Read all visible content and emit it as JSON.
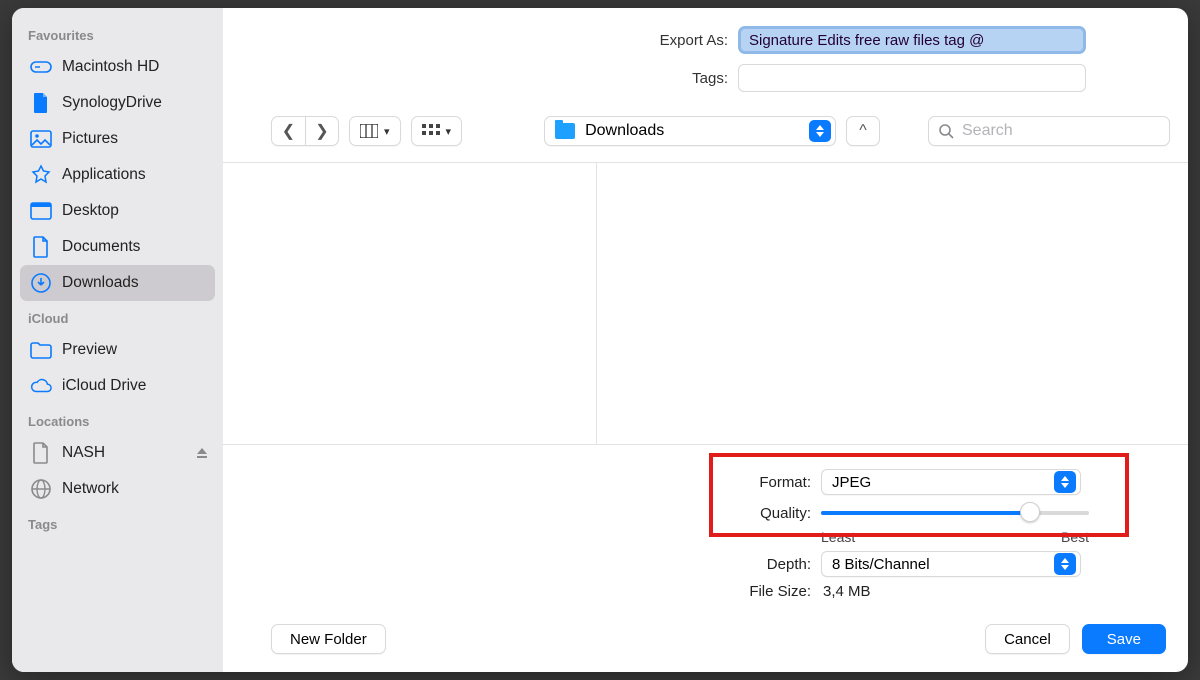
{
  "header": {
    "export_as_label": "Export As:",
    "filename_value": "Signature Edits free raw files tag @",
    "tags_label": "Tags:",
    "tags_value": ""
  },
  "toolbar": {
    "location_label": "Downloads",
    "search_placeholder": "Search"
  },
  "sidebar": {
    "favourites_header": "Favourites",
    "favourites": [
      {
        "label": "Macintosh HD",
        "icon": "disk"
      },
      {
        "label": "SynologyDrive",
        "icon": "doc"
      },
      {
        "label": "Pictures",
        "icon": "picture"
      },
      {
        "label": "Applications",
        "icon": "apps"
      },
      {
        "label": "Desktop",
        "icon": "desktop"
      },
      {
        "label": "Documents",
        "icon": "document"
      },
      {
        "label": "Downloads",
        "icon": "download",
        "selected": true
      }
    ],
    "icloud_header": "iCloud",
    "icloud": [
      {
        "label": "Preview",
        "icon": "folder"
      },
      {
        "label": "iCloud Drive",
        "icon": "cloud"
      }
    ],
    "locations_header": "Locations",
    "locations": [
      {
        "label": "NASH",
        "icon": "document",
        "ejectable": true
      },
      {
        "label": "Network",
        "icon": "globe"
      }
    ],
    "tags_header": "Tags"
  },
  "options": {
    "format_label": "Format:",
    "format_value": "JPEG",
    "quality_label": "Quality:",
    "quality_least": "Least",
    "quality_best": "Best",
    "depth_label": "Depth:",
    "depth_value": "8 Bits/Channel",
    "filesize_label": "File Size:",
    "filesize_value": "3,4 MB"
  },
  "footer": {
    "new_folder": "New Folder",
    "cancel": "Cancel",
    "save": "Save"
  },
  "colors": {
    "accent": "#0a7bff"
  }
}
